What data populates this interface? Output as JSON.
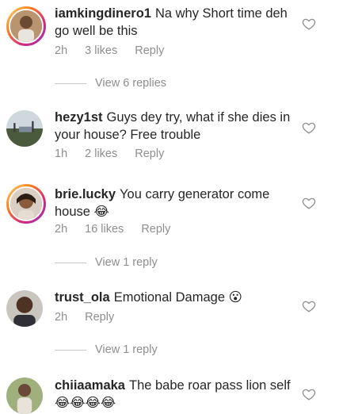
{
  "comments": [
    {
      "username": "iamkingdinero1",
      "text": "Na why Short time deh go well be this",
      "time": "2h",
      "likes": "3 likes",
      "reply": "Reply",
      "view_replies": "View 6 replies"
    },
    {
      "username": "hezy1st",
      "text": "Guys dey try, what if she dies in your house? Free trouble",
      "time": "1h",
      "likes": "2 likes",
      "reply": "Reply"
    },
    {
      "username": "brie.lucky",
      "text": "You carry generator come house 😂",
      "time": "2h",
      "likes": "16 likes",
      "reply": "Reply",
      "view_replies": "View 1 reply"
    },
    {
      "username": "trust_ola",
      "text": "Emotional Damage 😮",
      "time": "2h",
      "reply": "Reply",
      "view_replies": "View 1 reply"
    },
    {
      "username": "chiiaamaka",
      "text": "The babe roar pass lion self 😂😂😂😂"
    }
  ],
  "icons": {
    "like": "heart-outline-icon"
  },
  "colors": {
    "text": "#262626",
    "secondary": "#8e8e8e",
    "divider": "#c7c7c7"
  }
}
